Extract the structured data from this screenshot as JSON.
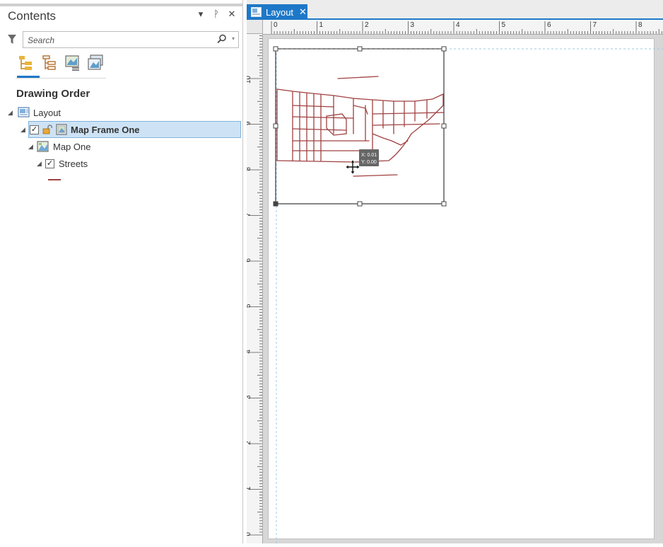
{
  "contents": {
    "title": "Contents",
    "search": {
      "placeholder": "Search"
    },
    "section_title": "Drawing Order",
    "tree": {
      "layout": "Layout",
      "map_frame": "Map Frame One",
      "map": "Map One",
      "layer": "Streets"
    },
    "colors": {
      "street_symbol": "#a04040",
      "accent": "#1e78c8",
      "selection": "#cde3f5"
    }
  },
  "layout_tab": {
    "label": "Layout",
    "close": "✕"
  },
  "ruler": {
    "horizontal_labels": [
      "0",
      "1",
      "2",
      "3",
      "4",
      "5",
      "6",
      "7",
      "8"
    ],
    "vertical_labels": [
      "10",
      "9",
      "8",
      "7",
      "6",
      "5",
      "4",
      "3",
      "2",
      "1",
      "0"
    ]
  },
  "coord_tooltip": {
    "x": "X: 0.01",
    "y": "Y: 0.00"
  }
}
